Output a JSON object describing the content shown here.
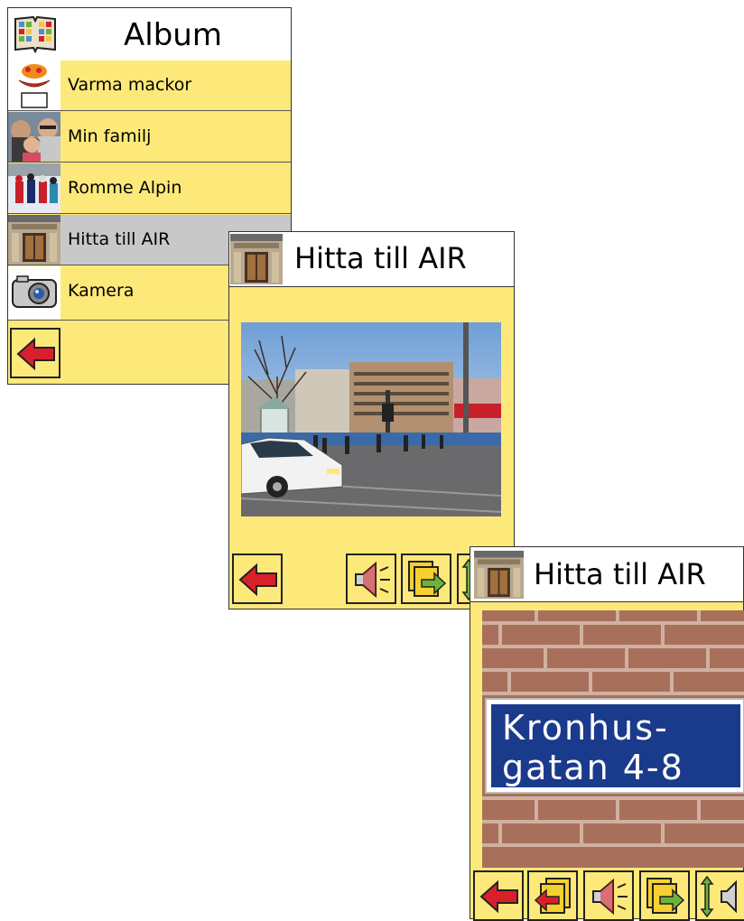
{
  "album": {
    "title": "Album",
    "items": [
      {
        "label": "Varma mackor"
      },
      {
        "label": "Min familj"
      },
      {
        "label": "Romme Alpin"
      },
      {
        "label": "Hitta till AIR"
      },
      {
        "label": "Kamera"
      }
    ],
    "selected_index": 3
  },
  "detail": {
    "title": "Hitta till AIR"
  },
  "detail2": {
    "title": "Hitta till AIR",
    "sign": {
      "line1": "Kronhus-",
      "line2": "gatan 4-8"
    }
  },
  "colors": {
    "panel_bg": "#fde97a",
    "selected_bg": "#c8c8c8",
    "arrow_red": "#d9202a",
    "arrow_green": "#6cb33a",
    "sign_blue": "#1a3a8c"
  },
  "icons": [
    "album-icon",
    "back-arrow-icon",
    "speaker-icon",
    "next-page-icon",
    "prev-page-icon",
    "scroll-icon",
    "camera-icon"
  ]
}
